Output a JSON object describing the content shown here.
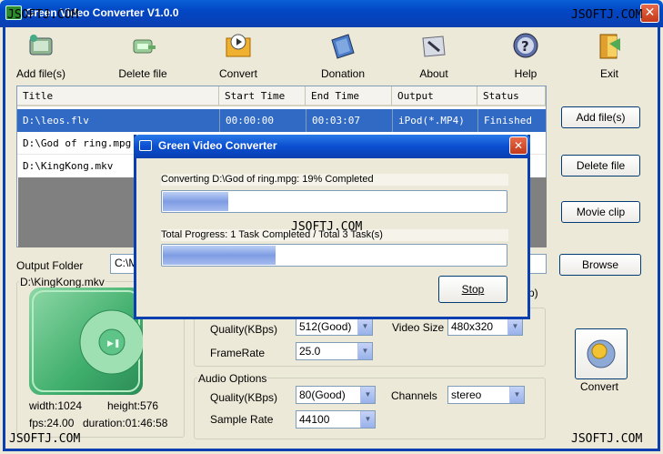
{
  "window": {
    "title": "Green Video Converter V1.0.0",
    "close_glyph": "✕"
  },
  "watermark": "JSOFTJ.COM",
  "toolbar": [
    {
      "label": "Add file(s)",
      "icon": "add-file-icon"
    },
    {
      "label": "Delete file",
      "icon": "delete-file-icon"
    },
    {
      "label": "Convert",
      "icon": "convert-icon"
    },
    {
      "label": "Donation",
      "icon": "donation-icon"
    },
    {
      "label": "About",
      "icon": "about-icon"
    },
    {
      "label": "Help",
      "icon": "help-icon"
    },
    {
      "label": "Exit",
      "icon": "exit-icon"
    }
  ],
  "table": {
    "columns": [
      "Title",
      "Start Time",
      "End Time",
      "Output",
      "Status"
    ],
    "rows": [
      {
        "title": "D:\\leos.flv",
        "start": "00:00:00",
        "end": "00:03:07",
        "output": "iPod(*.MP4)",
        "status": "Finished",
        "selected": true
      },
      {
        "title": "D:\\God of ring.mpg",
        "start": "",
        "end": "",
        "output": "",
        "status": "",
        "selected": false
      },
      {
        "title": "D:\\KingKong.mkv",
        "start": "",
        "end": "",
        "output": "",
        "status": "",
        "selected": false
      }
    ]
  },
  "side_buttons": {
    "add": "Add file(s)",
    "delete": "Delete file",
    "movie_clip": "Movie clip",
    "browse": "Browse"
  },
  "output_folder": {
    "label": "Output Folder",
    "value": "C:\\M"
  },
  "preview": {
    "file": "D:\\KingKong.mkv",
    "width": "width:1024",
    "height": "height:576",
    "fps": "fps:24.00",
    "duration": "duration:01:46:58"
  },
  "video_options": {
    "partial_label": "p)",
    "quality_label": "Quality(KBps)",
    "quality_value": "512(Good)",
    "framerate_label": "FrameRate",
    "framerate_value": "25.0",
    "size_label": "Video Size",
    "size_value": "480x320"
  },
  "audio_options": {
    "title": "Audio Options",
    "quality_label": "Quality(KBps)",
    "quality_value": "80(Good)",
    "samplerate_label": "Sample Rate",
    "samplerate_value": "44100",
    "channels_label": "Channels",
    "channels_value": "stereo"
  },
  "convert_button": {
    "label": "Convert"
  },
  "dialog": {
    "title": "Green Video Converter",
    "current_text": "Converting D:\\God of ring.mpg:  19% Completed",
    "current_progress": 0.19,
    "total_text": "Total Progress: 1 Task Completed / Total 3 Task(s)",
    "total_progress": 0.33,
    "stop_label": "Stop"
  },
  "colors": {
    "titlebar": "#0a4fd0",
    "selection": "#316ac5",
    "progress": "#7f9ce4"
  }
}
